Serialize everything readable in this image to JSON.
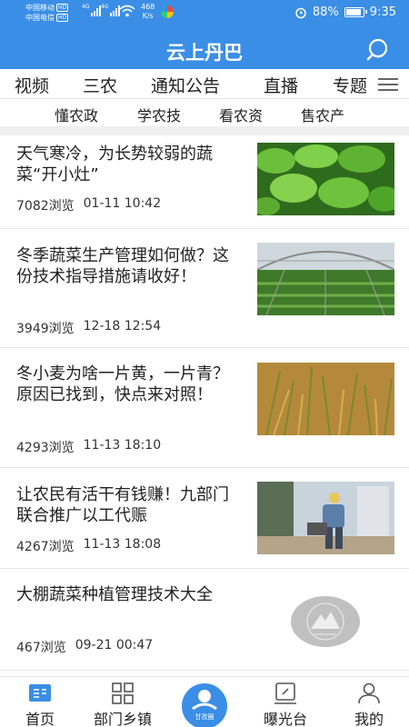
{
  "status_bar": {
    "carrier1": "中国移动",
    "carrier2": "中国电信",
    "hd": "HD",
    "net_label": "4G",
    "speed_value": "468",
    "speed_unit": "K/s",
    "battery": "88%",
    "battery_level": 0.88,
    "time": "9:35"
  },
  "header": {
    "title": "云上丹巴"
  },
  "tabs": [
    "视频",
    "三农",
    "通知公告",
    "直播",
    "专题"
  ],
  "subnav": [
    "懂农政",
    "学农技",
    "看农资",
    "售农产"
  ],
  "news": [
    {
      "title": "天气寒冷，为长势较弱的蔬菜“开小灶”",
      "views": "7082浏览",
      "time": "01-11 10:42"
    },
    {
      "title": "冬季蔬菜生产管理如何做？这份技术指导措施请收好！",
      "views": "3949浏览",
      "time": "12-18 12:54"
    },
    {
      "title": "冬小麦为啥一片黄，一片青？原因已找到，快点来对照！",
      "views": "4293浏览",
      "time": "11-13 18:10"
    },
    {
      "title": "让农民有活干有钱赚！九部门联合推广以工代赈",
      "views": "4267浏览",
      "time": "11-13 18:08"
    },
    {
      "title": "大棚蔬菜种植管理技术大全",
      "views": "467浏览",
      "time": "09-21 00:47"
    }
  ],
  "bottom_nav": {
    "home": "首页",
    "departments": "部门乡镇",
    "center": "甘孜圈",
    "exposure": "曝光台",
    "mine": "我的"
  },
  "colors": {
    "primary": "#3a8ee6",
    "divider": "#e8e8e8"
  }
}
